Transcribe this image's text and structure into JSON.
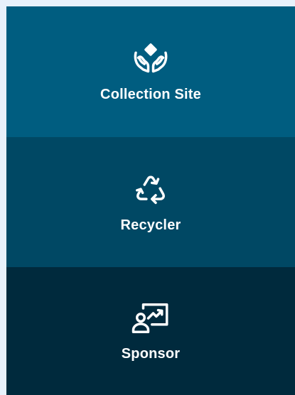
{
  "tiles": [
    {
      "label": "Collection Site",
      "icon": "hands-holding-diamond-icon",
      "background": "#005d80"
    },
    {
      "label": "Recycler",
      "icon": "recycle-arrows-icon",
      "background": "#004864"
    },
    {
      "label": "Sponsor",
      "icon": "presenter-chart-icon",
      "background": "#002a3d"
    }
  ],
  "colors": {
    "page_background": "#e8f1fb",
    "text": "#ffffff"
  }
}
